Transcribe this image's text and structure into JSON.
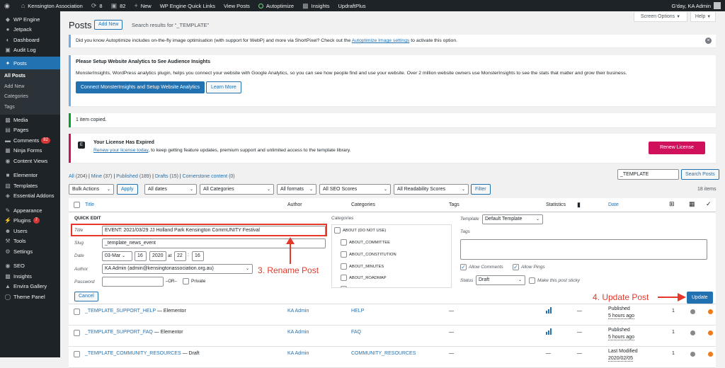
{
  "adminbar": {
    "site": "Kensington Association",
    "updates": "8",
    "comments": "82",
    "new": "New",
    "wpengine": "WP Engine Quick Links",
    "view": "View Posts",
    "autoptimize": "Autoptimize",
    "insights": "Insights",
    "updraft": "UpdraftPlus",
    "greeting": "G'day, KA Admin"
  },
  "sidebar": {
    "items": [
      {
        "label": "WP Engine",
        "icon": "wp-engine-icon"
      },
      {
        "label": "Jetpack",
        "icon": "jetpack-icon"
      },
      {
        "label": "Dashboard",
        "icon": "dashboard-icon"
      },
      {
        "label": "Audit Log",
        "icon": "audit-log-icon"
      },
      {
        "label": "Posts",
        "icon": "pin-icon"
      },
      {
        "label": "Media",
        "icon": "media-icon"
      },
      {
        "label": "Pages",
        "icon": "pages-icon"
      },
      {
        "label": "Comments",
        "icon": "comments-icon",
        "badge": "82"
      },
      {
        "label": "Ninja Forms",
        "icon": "forms-icon"
      },
      {
        "label": "Content Views",
        "icon": "views-icon"
      },
      {
        "label": "Elementor",
        "icon": "elementor-icon"
      },
      {
        "label": "Templates",
        "icon": "templates-icon"
      },
      {
        "label": "Essential Addons",
        "icon": "addons-icon"
      },
      {
        "label": "Appearance",
        "icon": "brush-icon"
      },
      {
        "label": "Plugins",
        "icon": "plugin-icon",
        "badge": "7"
      },
      {
        "label": "Users",
        "icon": "users-icon"
      },
      {
        "label": "Tools",
        "icon": "tools-icon"
      },
      {
        "label": "Settings",
        "icon": "settings-icon"
      },
      {
        "label": "SEO",
        "icon": "seo-icon"
      },
      {
        "label": "Insights",
        "icon": "insights-icon"
      },
      {
        "label": "Envira Gallery",
        "icon": "gallery-icon"
      },
      {
        "label": "Theme Panel",
        "icon": "theme-icon"
      }
    ],
    "posts_sub": [
      "All Posts",
      "Add New",
      "Categories",
      "Tags"
    ]
  },
  "header": {
    "title": "Posts",
    "add_new": "Add New",
    "search_results": "Search results for “_TEMPLATE”",
    "screen_options": "Screen Options",
    "help": "Help"
  },
  "notices": {
    "autoptimize_text": "Did you know Autoptimize includes on-the-fly image optimisation (with support for WebP) and more via ShortPixel? Check out the",
    "autoptimize_link": "Autoptimize Image settings",
    "autoptimize_tail": "to activate this option.",
    "mi_title": "Please Setup Website Analytics to See Audience Insights",
    "mi_text": "MonsterInsights, WordPress analytics plugin, helps you connect your website with Google Analytics, so you can see how people find and use your website. Over 2 million website owners use MonsterInsights to see the stats that matter and grow their business.",
    "mi_connect": "Connect MonsterInsights and Setup Website Analytics",
    "mi_learn": "Learn More",
    "copied": "1 item copied.",
    "license_title": "Your License Has Expired",
    "license_link": "Renew your license today",
    "license_text": ", to keep getting feature updates, premium support and unlimited access to the template library.",
    "license_btn": "Renew License"
  },
  "filters": {
    "all": "All",
    "all_count": "(204)",
    "mine": "Mine",
    "mine_count": "(37)",
    "published": "Published",
    "published_count": "(189)",
    "drafts": "Drafts",
    "drafts_count": "(15)",
    "cornerstone": "Cornerstone content",
    "cornerstone_count": "(0)",
    "search_value": "_TEMPLATE",
    "search_btn": "Search Posts",
    "bulk": "Bulk Actions",
    "apply": "Apply",
    "dates": "All dates",
    "categories": "All Categories",
    "formats": "All formats",
    "seo": "All SEO Scores",
    "readability": "All Readability Scores",
    "filter": "Filter",
    "items": "18 items"
  },
  "table": {
    "title": "Title",
    "author": "Author",
    "categories": "Categories",
    "tags": "Tags",
    "statistics": "Statistics",
    "date": "Date"
  },
  "quick_edit": {
    "heading": "QUICK EDIT",
    "title_label": "Title",
    "title_value": "EVENT: 2021/03/29 JJ Holland Park Kensington CommUNITY Festival",
    "slug_label": "Slug",
    "slug_value": "_template_news_event",
    "date_label": "Date",
    "month": "03-Mar",
    "day": "16",
    "year": "2020",
    "at": "at",
    "hour": "22",
    "minute": "16",
    "author_label": "Author",
    "author_value": "KA Admin (admin@kensingtonassociation.org.au)",
    "password_label": "Password",
    "or": "–OR–",
    "private": "Private",
    "categories_label": "Categories",
    "cats": [
      "ABOUT (DO NOT USE)",
      "ABOUT_COMMITTEE",
      "ABOUT_CONSTITUTION",
      "ABOUT_MINUTES",
      "ABOUT_ROADMAP",
      "ABOUT_STEERING_GROUP"
    ],
    "template_label": "Template",
    "template_value": "Default Template",
    "tags_label": "Tags",
    "allow_comments": "Allow Comments",
    "allow_pings": "Allow Pings",
    "status_label": "Status",
    "status_value": "Draft",
    "sticky": "Make this post sticky",
    "cancel": "Cancel",
    "update": "Update"
  },
  "annotations": {
    "rename": "3. Rename Post",
    "update": "4. Update Post"
  },
  "rows": [
    {
      "title": "_TEMPLATE_SUPPORT_HELP",
      "state": "— Elementor",
      "author": "KA Admin",
      "category": "HELP",
      "tags": "—",
      "comments": "—",
      "date_status": "Published",
      "date_ago": "5 hours ago",
      "num": "1"
    },
    {
      "title": "_TEMPLATE_SUPPORT_FAQ",
      "state": "— Elementor",
      "author": "KA Admin",
      "category": "FAQ",
      "tags": "—",
      "comments": "—",
      "date_status": "Published",
      "date_ago": "5 hours ago",
      "num": "1"
    },
    {
      "title": "_TEMPLATE_COMMUNITY_RESOURCES",
      "state": "— Draft",
      "author": "KA Admin",
      "category": "COMMUNITY_RESOURCES",
      "tags": "—",
      "stats": "—",
      "comments": "—",
      "date_status": "Last Modified",
      "date_ago": "2020/02/05",
      "num": "1"
    }
  ],
  "colors": {
    "accent": "#2271b1",
    "license": "#d0105b",
    "annotation": "#e5382a"
  }
}
